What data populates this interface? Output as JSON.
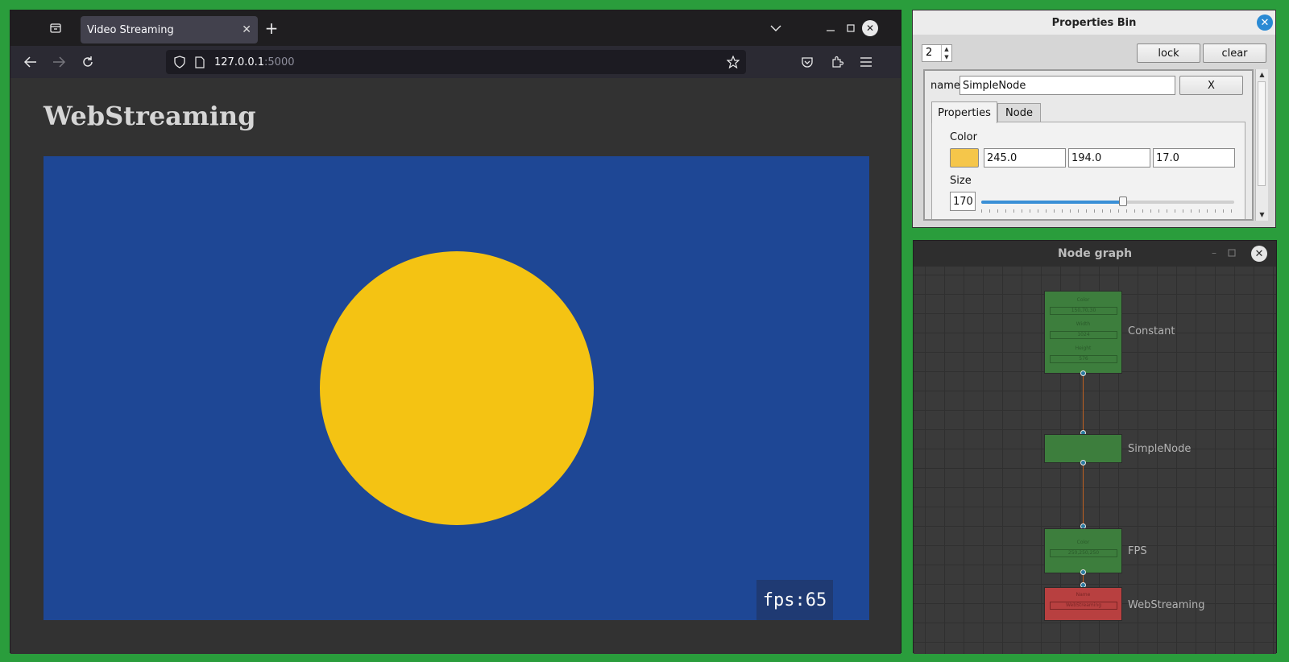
{
  "browser": {
    "tab_title": "Video Streaming",
    "url_host": "127.0.0.1",
    "url_port": ":5000",
    "page_heading": "WebStreaming",
    "fps_overlay": "fps:65"
  },
  "properties_bin": {
    "title": "Properties Bin",
    "spin_value": "2",
    "lock_label": "lock",
    "clear_label": "clear",
    "name_label": "name",
    "name_value": "SimpleNode",
    "remove_label": "X",
    "tabs": [
      "Properties",
      "Node"
    ],
    "color_label": "Color",
    "color_swatch": "#f5c211",
    "color_values": [
      "245.0",
      "194.0",
      "17.0"
    ],
    "size_label": "Size",
    "size_value": "170",
    "size_slider_fraction": 0.56
  },
  "node_graph": {
    "title": "Node graph",
    "nodes": [
      {
        "label": "Constant",
        "fields": [
          {
            "name": "Color",
            "value": "150,70,30"
          },
          {
            "name": "Width",
            "value": "1024"
          },
          {
            "name": "Height",
            "value": "576"
          }
        ]
      },
      {
        "label": "SimpleNode",
        "fields": []
      },
      {
        "label": "FPS",
        "fields": [
          {
            "name": "Color",
            "value": "250,250,250"
          }
        ]
      },
      {
        "label": "WebStreaming",
        "fields": [
          {
            "name": "Name",
            "value": "WebStreaming"
          }
        ]
      }
    ]
  },
  "colors": {
    "desktop": "#2a9d3c",
    "stream_background": "#1e4795",
    "circle": "#f4c313",
    "node_green": "#3d7e3d",
    "node_red": "#b84040"
  }
}
